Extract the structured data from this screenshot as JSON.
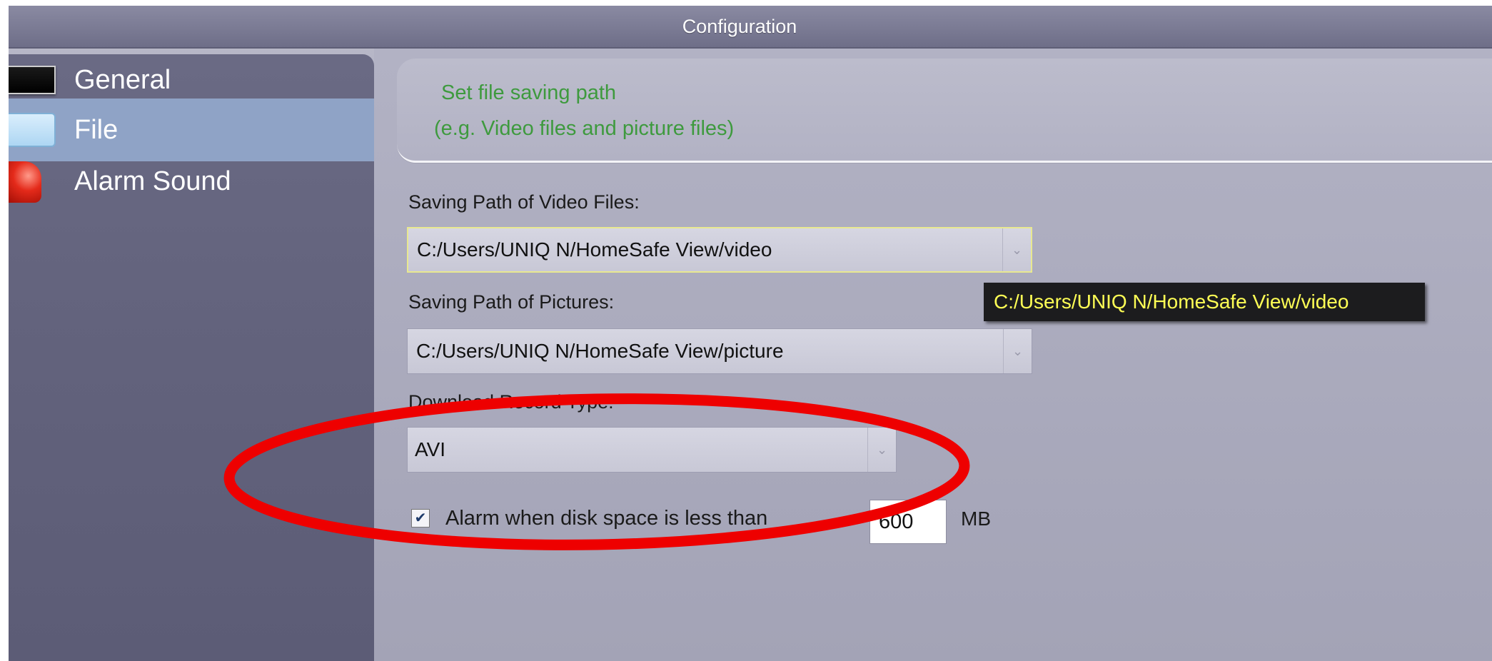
{
  "window": {
    "title": "Configuration"
  },
  "sidebar": {
    "items": [
      {
        "label": "General",
        "icon": "monitor-icon"
      },
      {
        "label": "File",
        "icon": "folder-icon",
        "selected": true
      },
      {
        "label": "Alarm Sound",
        "icon": "alarm-icon"
      }
    ]
  },
  "header": {
    "line1": "Set file saving path",
    "line2": "(e.g. Video files and picture files)"
  },
  "video_path": {
    "label": "Saving Path of Video Files:",
    "value": "C:/Users/UNIQ N/HomeSafe View/video"
  },
  "tooltip": {
    "text": "C:/Users/UNIQ N/HomeSafe View/video"
  },
  "picture_path": {
    "label": "Saving Path of Pictures:",
    "value": "C:/Users/UNIQ N/HomeSafe View/picture"
  },
  "record_type": {
    "label": "Download Record Type:",
    "value": "AVI"
  },
  "disk_alarm": {
    "label": "Alarm when disk space is less than",
    "checked": true,
    "value": "600",
    "unit": "MB"
  },
  "colors": {
    "header_text": "#3e9a3e",
    "sidebar_selected": "#8fa3c6",
    "tooltip_text": "#ffff55",
    "annotation": "#ee0000"
  }
}
